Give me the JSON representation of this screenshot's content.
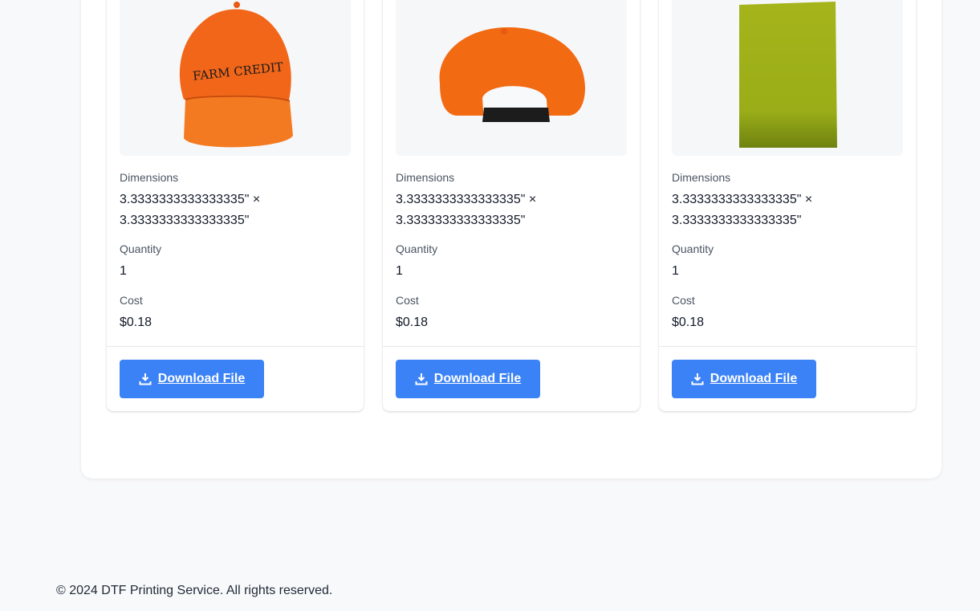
{
  "cards": [
    {
      "image": "orange-cap-front-farm-credit",
      "image_text": "FARM CREDIT",
      "dimensions_label": "Dimensions",
      "dimensions_line1": "3.3333333333333335\" ×",
      "dimensions_line2": "3.3333333333333335\"",
      "quantity_label": "Quantity",
      "quantity": "1",
      "cost_label": "Cost",
      "cost": "$0.18",
      "download_label": "Download File",
      "download_icon": "download-icon"
    },
    {
      "image": "orange-cap-back",
      "dimensions_label": "Dimensions",
      "dimensions_line1": "3.3333333333333335\" ×",
      "dimensions_line2": "3.3333333333333335\"",
      "quantity_label": "Quantity",
      "quantity": "1",
      "cost_label": "Cost",
      "cost": "$0.18",
      "download_label": "Download File",
      "download_icon": "download-icon"
    },
    {
      "image": "green-rectangle-swatch",
      "dimensions_label": "Dimensions",
      "dimensions_line1": "3.3333333333333335\" ×",
      "dimensions_line2": "3.3333333333333335\"",
      "quantity_label": "Quantity",
      "quantity": "1",
      "cost_label": "Cost",
      "cost": "$0.18",
      "download_label": "Download File",
      "download_icon": "download-icon"
    }
  ],
  "footer": {
    "text": "© 2024 DTF Printing Service. All rights reserved."
  },
  "colors": {
    "button": "#3b82f6",
    "page_bg": "#f8f9fb",
    "cap_orange": "#f26a12",
    "swatch_green": "#a3b21a"
  }
}
